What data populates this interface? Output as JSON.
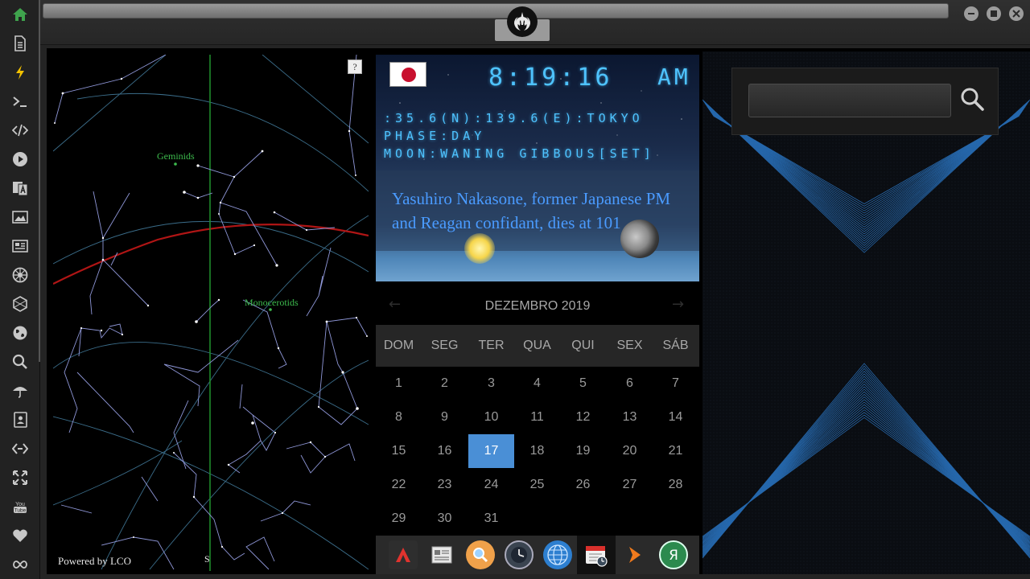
{
  "sidebar": {
    "items": [
      {
        "name": "home-icon",
        "active": true
      },
      {
        "name": "document-icon"
      },
      {
        "name": "lightning-icon"
      },
      {
        "name": "terminal-icon"
      },
      {
        "name": "code-icon"
      },
      {
        "name": "play-icon"
      },
      {
        "name": "translate-icon"
      },
      {
        "name": "image-icon"
      },
      {
        "name": "newspaper-icon"
      },
      {
        "name": "empire-icon"
      },
      {
        "name": "hexagon-icon"
      },
      {
        "name": "globe-icon"
      },
      {
        "name": "search-icon"
      },
      {
        "name": "umbrella-icon"
      },
      {
        "name": "contact-icon"
      },
      {
        "name": "code-link-icon"
      },
      {
        "name": "expand-icon"
      },
      {
        "name": "youtube-icon",
        "label": "You Tube"
      },
      {
        "name": "heart-icon"
      },
      {
        "name": "infinity-icon"
      }
    ]
  },
  "topbar": {
    "logo_icon": "rebel-alliance-icon"
  },
  "skymap": {
    "help": "?",
    "labels": [
      "Geminids",
      "Monocerotids"
    ],
    "powered": "Powered by LCO",
    "direction": "S"
  },
  "clock": {
    "flag": "japan-flag",
    "time": "8:19:16",
    "ampm": "AM",
    "coordinates": ":35.6(N):139.6(E):TOKYO",
    "phase": "PHASE:DAY",
    "moon": "MOON:WANING GIBBOUS[SET]",
    "headline": "Yasuhiro Nakasone, former Japanese PM and Reagan confidant, dies at 101"
  },
  "calendar": {
    "title": "DEZEMBRO 2019",
    "prev": "←",
    "next": "→",
    "weekdays": [
      "DOM",
      "SEG",
      "TER",
      "QUA",
      "QUI",
      "SEX",
      "SÁB"
    ],
    "weeks": [
      [
        "1",
        "2",
        "3",
        "4",
        "5",
        "6",
        "7"
      ],
      [
        "8",
        "9",
        "10",
        "11",
        "12",
        "13",
        "14"
      ],
      [
        "15",
        "16",
        "17",
        "18",
        "19",
        "20",
        "21"
      ],
      [
        "22",
        "23",
        "24",
        "25",
        "26",
        "27",
        "28"
      ],
      [
        "29",
        "30",
        "31",
        "",
        "",
        "",
        ""
      ]
    ],
    "today": "17"
  },
  "dock": {
    "items": [
      "autodesk-icon",
      "newspaper-icon",
      "search-icon",
      "clock-icon",
      "globe-icon",
      "calendar-icon",
      "play-icon",
      "yandex-icon"
    ]
  },
  "search": {
    "placeholder": "",
    "value": ""
  },
  "colors": {
    "accent": "#4a8fd6",
    "home": "#3fa34d",
    "digital": "#4ec3ff",
    "headline": "#4a9bff",
    "ecliptic": "#b01515",
    "meridian": "#1e8a2a"
  }
}
